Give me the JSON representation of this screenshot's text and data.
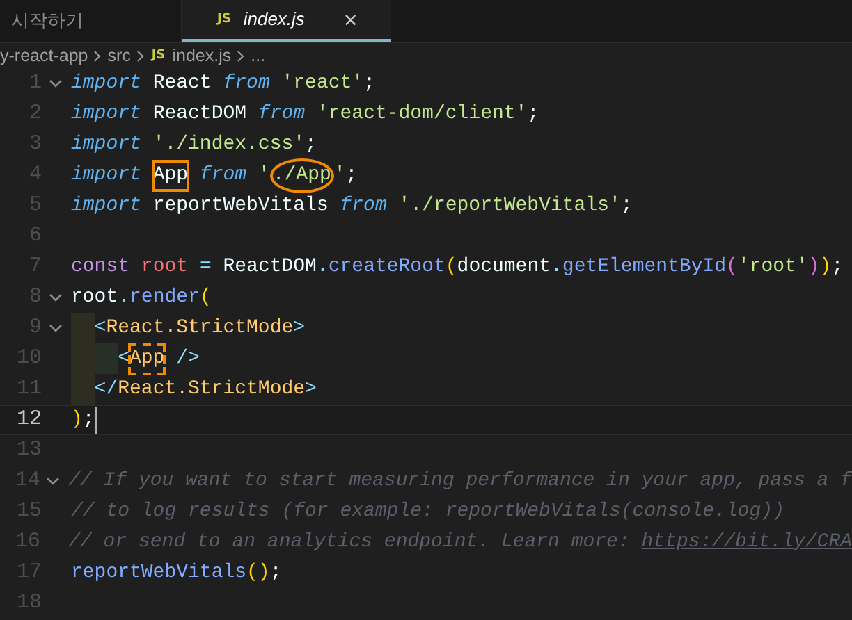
{
  "tabs": [
    {
      "label": "시작하기",
      "selected": false
    },
    {
      "label": "index.js",
      "badge": "JS",
      "selected": true,
      "close": "×"
    }
  ],
  "breadcrumb": [
    {
      "label": "y-react-app"
    },
    {
      "label": "src"
    },
    {
      "badge": "JS",
      "label": "index.js"
    },
    {
      "label": "..."
    }
  ],
  "editor": {
    "lines": [
      {
        "number": "1",
        "fold": true,
        "current": false,
        "tokens": [
          {
            "text": "import",
            "kind": "keyword"
          },
          {
            "text": " React ",
            "kind": "ident"
          },
          {
            "text": "from",
            "kind": "keyword"
          },
          {
            "text": " 'react'",
            "kind": "string"
          },
          {
            "text": ";",
            "kind": "ident"
          }
        ]
      },
      {
        "number": "2",
        "fold": false,
        "current": false,
        "tokens": [
          {
            "text": "import",
            "kind": "keyword"
          },
          {
            "text": " ReactDOM ",
            "kind": "ident"
          },
          {
            "text": "from",
            "kind": "keyword"
          },
          {
            "text": " 'react-dom/client'",
            "kind": "string"
          },
          {
            "text": ";",
            "kind": "ident"
          }
        ]
      },
      {
        "number": "3",
        "fold": false,
        "current": false,
        "tokens": [
          {
            "text": "import",
            "kind": "keyword"
          },
          {
            "text": " './index.css'",
            "kind": "string"
          },
          {
            "text": ";",
            "kind": "ident"
          }
        ]
      },
      {
        "number": "4",
        "fold": false,
        "current": false,
        "tokens": [
          {
            "text": "import ",
            "kind": "keyword"
          },
          {
            "text": "App",
            "kind": "ident",
            "annotation": {
              "kind": "box"
            }
          },
          {
            "text": " from",
            "kind": "keyword"
          },
          {
            "text": " '",
            "kind": "string"
          },
          {
            "text": "./App",
            "kind": "string",
            "annotation": {
              "kind": "circle"
            }
          },
          {
            "text": "'",
            "kind": "string"
          },
          {
            "text": ";",
            "kind": "ident"
          }
        ]
      },
      {
        "number": "5",
        "fold": false,
        "current": false,
        "tokens": [
          {
            "text": "import",
            "kind": "keyword"
          },
          {
            "text": " reportWebVitals ",
            "kind": "ident"
          },
          {
            "text": "from",
            "kind": "keyword"
          },
          {
            "text": " './reportWebVitals'",
            "kind": "string"
          },
          {
            "text": ";",
            "kind": "ident"
          }
        ]
      },
      {
        "number": "6",
        "fold": false,
        "current": false
      },
      {
        "number": "7",
        "fold": false,
        "current": false,
        "tokens": [
          {
            "text": "const",
            "kind": "storage"
          },
          {
            "text": " root ",
            "kind": "variable"
          },
          {
            "text": "=",
            "kind": "operator"
          },
          {
            "text": " ReactDOM",
            "kind": "ident"
          },
          {
            "text": ".",
            "kind": "operator"
          },
          {
            "text": "createRoot",
            "kind": "method"
          },
          {
            "text": "(",
            "kind": "paren"
          },
          {
            "text": "document",
            "kind": "ident"
          },
          {
            "text": ".",
            "kind": "operator"
          },
          {
            "text": "getElementById",
            "kind": "method"
          },
          {
            "text": "(",
            "kind": "paren2"
          },
          {
            "text": "'root'",
            "kind": "string"
          },
          {
            "text": ")",
            "kind": "paren2"
          },
          {
            "text": ")",
            "kind": "paren"
          },
          {
            "text": ";",
            "kind": "ident"
          }
        ]
      },
      {
        "number": "8",
        "fold": true,
        "current": false,
        "tokens": [
          {
            "text": "root",
            "kind": "ident"
          },
          {
            "text": ".",
            "kind": "operator"
          },
          {
            "text": "render",
            "kind": "method"
          },
          {
            "text": "(",
            "kind": "paren"
          }
        ]
      },
      {
        "number": "9",
        "fold": true,
        "current": false,
        "tokens": [
          {
            "text": "  <",
            "kind": "operator"
          },
          {
            "text": "React.StrictMode",
            "kind": "tag"
          },
          {
            "text": ">",
            "kind": "operator"
          }
        ]
      },
      {
        "number": "10",
        "fold": false,
        "current": false,
        "tokens": [
          {
            "text": "    <",
            "kind": "operator"
          },
          {
            "text": "App",
            "kind": "tag",
            "annotation": {
              "kind": "dotted"
            }
          },
          {
            "text": " />",
            "kind": "operator"
          }
        ]
      },
      {
        "number": "11",
        "fold": false,
        "current": false,
        "tokens": [
          {
            "text": "  </",
            "kind": "operator"
          },
          {
            "text": "React.StrictMode",
            "kind": "tag"
          },
          {
            "text": ">",
            "kind": "operator"
          }
        ]
      },
      {
        "number": "12",
        "fold": false,
        "current": true,
        "tokens": [
          {
            "text": ")",
            "kind": "paren"
          },
          {
            "text": ";",
            "kind": "ident"
          }
        ]
      },
      {
        "number": "13",
        "fold": false,
        "current": false
      },
      {
        "number": "14",
        "fold": true,
        "current": false,
        "tokens": [
          {
            "text": "// If you want to start measuring performance in your app, pass a f",
            "kind": "comment"
          }
        ]
      },
      {
        "number": "15",
        "fold": false,
        "current": false,
        "tokens": [
          {
            "text": "// to log results (for example: reportWebVitals(console.log))",
            "kind": "comment"
          }
        ]
      },
      {
        "number": "16",
        "fold": false,
        "current": false,
        "tokens": [
          {
            "text": "// or send to an analytics endpoint. Learn more: ",
            "kind": "comment"
          },
          {
            "text": "https://bit.ly/CRA",
            "kind": "link"
          }
        ]
      },
      {
        "number": "17",
        "fold": false,
        "current": false,
        "tokens": [
          {
            "text": "reportWebVitals",
            "kind": "method"
          },
          {
            "text": "()",
            "kind": "paren"
          },
          {
            "text": ";",
            "kind": "ident"
          }
        ]
      },
      {
        "number": "18",
        "fold": false,
        "current": false
      }
    ]
  }
}
